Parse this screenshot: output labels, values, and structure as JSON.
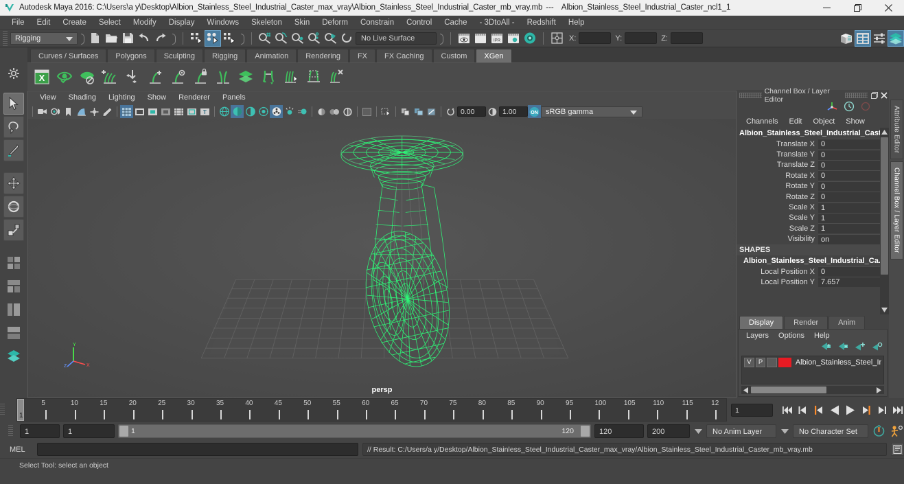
{
  "window": {
    "title": "Autodesk Maya 2016: C:\\Users\\a y\\Desktop\\Albion_Stainless_Steel_Industrial_Caster_max_vray\\Albion_Stainless_Steel_Industrial_Caster_mb_vray.mb",
    "title_separator": "---",
    "subtitle": "Albion_Stainless_Steel_Industrial_Caster_ncl1_1",
    "minimize_label": "Minimize",
    "maximize_label": "Restore",
    "close_label": "Close"
  },
  "menubar": {
    "items": [
      "File",
      "Edit",
      "Create",
      "Select",
      "Modify",
      "Display",
      "Windows",
      "Skeleton",
      "Skin",
      "Deform",
      "Constrain",
      "Control",
      "Cache",
      "- 3DtoAll -",
      "Redshift",
      "Help"
    ]
  },
  "statusline": {
    "mode": "Rigging",
    "live_surface": "No Live Surface",
    "coord_x_label": "X:",
    "coord_y_label": "Y:",
    "coord_z_label": "Z:",
    "coord_x_value": "",
    "coord_y_value": "",
    "coord_z_value": "",
    "icons": [
      "new-scene-icon",
      "open-scene-icon",
      "save-scene-icon",
      "undo-icon",
      "redo-icon",
      "select-hierarchy-icon",
      "select-object-icon",
      "select-component-icon",
      "snap-grid-icon",
      "snap-curve-icon",
      "snap-point-icon",
      "snap-projected-center-icon",
      "snap-view-plane-icon",
      "make-live-icon",
      "render-current-frame-icon",
      "render-sequence-icon",
      "ipr-render-icon",
      "render-settings-icon",
      "hypershade-icon",
      "four-view-layout-icon",
      "outliner-icon",
      "graph-editor-icon",
      "attribute-editor-icon",
      "channel-box-icon"
    ]
  },
  "shelf": {
    "tabs": [
      "Curves / Surfaces",
      "Polygons",
      "Sculpting",
      "Rigging",
      "Animation",
      "Rendering",
      "FX",
      "FX Caching",
      "Custom",
      "XGen"
    ],
    "active_tab": "XGen",
    "icons": [
      "xgen-window-icon",
      "preview-refresh-icon",
      "disable-preview-icon",
      "add-grooming-description-icon",
      "convert-to-interactive-icon",
      "add-guide-icon",
      "select-guide-icon",
      "freeze-guide-icon",
      "mirror-guide-icon",
      "layer-tool-icon",
      "flip-guide-icon",
      "comb-brush-icon",
      "clump-tool-icon",
      "delete-guide-icon"
    ]
  },
  "toolbox": {
    "tools": [
      {
        "name": "select-tool",
        "active": true
      },
      {
        "name": "lasso-select-tool",
        "active": false
      },
      {
        "name": "paint-select-tool",
        "active": false
      },
      {
        "name": "move-tool",
        "active": false
      },
      {
        "name": "rotate-tool",
        "active": false
      },
      {
        "name": "scale-tool",
        "active": false
      },
      {
        "name": "last-tool-used",
        "active": false
      },
      {
        "name": "four-view-layout-icon",
        "active": false
      },
      {
        "name": "two-pane-layout-icon",
        "active": false
      },
      {
        "name": "single-perspective-layout-icon",
        "active": false
      },
      {
        "name": "outliner-persp-layout-icon",
        "active": false
      },
      {
        "name": "hypershade-persp-layout-icon",
        "active": false
      }
    ]
  },
  "viewport": {
    "menus": [
      "View",
      "Shading",
      "Lighting",
      "Show",
      "Renderer",
      "Panels"
    ],
    "camera_label": "persp",
    "exposure_value": "0.00",
    "gamma_value": "1.00",
    "color_management": "sRGB gamma",
    "axis_labels": [
      "Y",
      "X",
      "Z"
    ],
    "toolbar_icons": [
      "camera-select-icon",
      "camera-attributes-icon",
      "bookmark-icon",
      "image-plane-icon",
      "2d-pan-zoom-icon",
      "grease-pencil-icon",
      "grid-toggle-icon",
      "film-gate-icon",
      "resolution-gate-icon",
      "gate-mask-icon",
      "field-chart-icon",
      "safe-action-icon",
      "safe-title-icon",
      "wireframe-icon",
      "smooth-shade-all-icon",
      "shade-textured-icon",
      "use-all-lights-icon",
      "shadows-icon",
      "screen-space-ambient-occlusion-icon",
      "motion-blur-icon",
      "multisample-icon",
      "depth-of-field-icon",
      "isolate-select-icon",
      "xray-icon",
      "xray-joints-icon",
      "xray-active-components-icon",
      "exposure-icon",
      "gamma-icon",
      "color-management-toggle-icon"
    ]
  },
  "channelbox": {
    "panel_title": "Channel Box / Layer Editor",
    "menus": [
      "Channels",
      "Edit",
      "Object",
      "Show"
    ],
    "node_name": "Albion_Stainless_Steel_Industrial_Cast...",
    "transform_channels": [
      {
        "label": "Translate X",
        "value": "0"
      },
      {
        "label": "Translate Y",
        "value": "0"
      },
      {
        "label": "Translate Z",
        "value": "0"
      },
      {
        "label": "Rotate X",
        "value": "0"
      },
      {
        "label": "Rotate Y",
        "value": "0"
      },
      {
        "label": "Rotate Z",
        "value": "0"
      },
      {
        "label": "Scale X",
        "value": "1"
      },
      {
        "label": "Scale Y",
        "value": "1"
      },
      {
        "label": "Scale Z",
        "value": "1"
      },
      {
        "label": "Visibility",
        "value": "on"
      }
    ],
    "shapes_header": "SHAPES",
    "shape_name": "Albion_Stainless_Steel_Industrial_Ca...",
    "shape_channels": [
      {
        "label": "Local Position X",
        "value": "0"
      },
      {
        "label": "Local Position Y",
        "value": "7.657"
      }
    ],
    "side_tabs": [
      "Attribute Editor",
      "Channel Box / Layer Editor"
    ],
    "active_side_tab": "Channel Box / Layer Editor"
  },
  "layereditor": {
    "tabs": [
      "Display",
      "Render",
      "Anim"
    ],
    "active_tab": "Display",
    "menus": [
      "Layers",
      "Options",
      "Help"
    ],
    "icons": [
      "move-layer-up-icon",
      "move-layer-down-icon",
      "new-layer-icon",
      "new-layer-from-selected-icon"
    ],
    "layers": [
      {
        "visibility": "V",
        "playback": "P",
        "shading": "",
        "color": "#e81b23",
        "name": "Albion_Stainless_Steel_In"
      }
    ]
  },
  "timeslider": {
    "current_frame": "1",
    "frame_field": "1",
    "tick_labels": [
      "5",
      "10",
      "15",
      "20",
      "25",
      "30",
      "35",
      "40",
      "45",
      "50",
      "55",
      "60",
      "65",
      "70",
      "75",
      "80",
      "85",
      "90",
      "95",
      "100",
      "105",
      "110",
      "115",
      "12"
    ],
    "playback_buttons": [
      "go-to-start-icon",
      "step-back-key-icon",
      "step-back-frame-icon",
      "play-backwards-icon",
      "play-forwards-icon",
      "step-forward-frame-icon",
      "step-forward-key-icon",
      "go-to-end-icon"
    ]
  },
  "rangeslider": {
    "anim_start": "1",
    "playback_start": "1",
    "range_start_label": "1",
    "range_end_label": "120",
    "playback_end": "120",
    "anim_end": "200",
    "anim_layer": "No Anim Layer",
    "character_set": "No Character Set",
    "auto_key_icon": "auto-keyframe-icon",
    "anim_prefs_icon": "animation-preferences-icon"
  },
  "commandline": {
    "language": "MEL",
    "input_value": "",
    "result_text": "// Result: C:/Users/a y/Desktop/Albion_Stainless_Steel_Industrial_Caster_max_vray/Albion_Stainless_Steel_Industrial_Caster_mb_vray.mb",
    "script_editor_icon": "script-editor-icon"
  },
  "statusbar": {
    "help_text": "Select Tool: select an object"
  },
  "colors": {
    "accent_teal": "#2db7a8",
    "selection_green": "#2dff7a",
    "highlight_blue": "#49749a",
    "layer_red": "#e81b23",
    "panel_bg": "#444444"
  }
}
